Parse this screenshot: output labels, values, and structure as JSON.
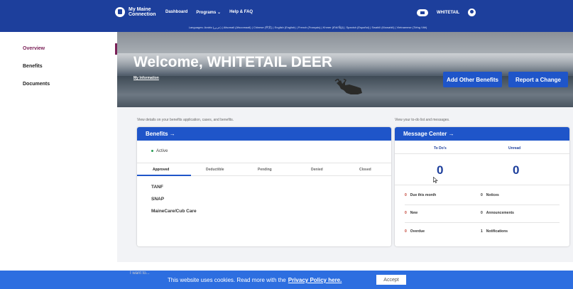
{
  "header": {
    "brand": "My Maine Connection",
    "nav": [
      "Dashboard",
      "Programs ⌄",
      "Help & FAQ"
    ],
    "user_name": "WHITETAIL",
    "languages": "Languages: Arabic (عربي) | Afsomali (Afsoomaali) | Chinese (中文) | English (English) | French (Français) | Khmer (ភាសាខ្មែរ) | Spanish (Español) | Swahili (Kiswahili) | Vietnamese (Tiếng Việt)"
  },
  "sidebar": {
    "items": [
      {
        "label": "Overview"
      },
      {
        "label": "Benefits"
      },
      {
        "label": "Documents"
      }
    ]
  },
  "hero": {
    "welcome": "Welcome, WHITETAIL DEER",
    "my_information": "My Information",
    "add_benefits": "Add Other Benefits",
    "report_change": "Report a Change"
  },
  "benefits": {
    "caption": "View details on your benefits application, cases, and benefits.",
    "title": "Benefits →",
    "status": "Active",
    "tabs": [
      "Approved",
      "Deductible",
      "Pending",
      "Denied",
      "Closed"
    ],
    "programs": [
      "TANF",
      "SNAP",
      "MaineCare/Cub Care"
    ]
  },
  "message_center": {
    "caption": "View your to-do list and messages.",
    "title": "Message Center →",
    "todos_label": "To Do's",
    "unread_label": "Unread",
    "todos_count": "0",
    "unread_count": "0",
    "rows": [
      {
        "left_count": "0",
        "left_label": "Due this month",
        "right_count": "0",
        "right_label": "Notices"
      },
      {
        "left_count": "0",
        "left_label": "New",
        "right_count": "0",
        "right_label": "Announcements"
      },
      {
        "left_count": "0",
        "left_label": "Overdue",
        "right_count": "1",
        "right_label": "Notifications"
      }
    ]
  },
  "footer": {
    "i_want_to": "I want to..."
  },
  "cookie": {
    "text": "This website uses cookies. Read more with the",
    "link": "Privacy Policy here.",
    "accept": "Accept"
  }
}
